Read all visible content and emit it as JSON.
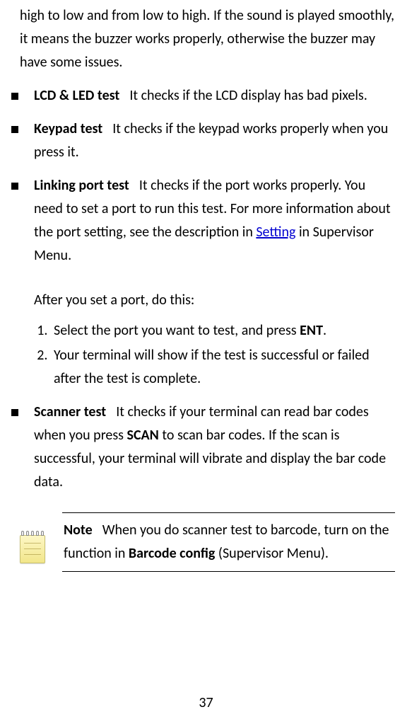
{
  "trailing": "high to low and from low to high. If the sound is played smoothly, it means the buzzer works properly, otherwise the buzzer may have some issues.",
  "tests": {
    "lcd": {
      "title": "LCD & LED test",
      "desc": "It checks if the LCD display has bad pixels."
    },
    "keypad": {
      "title": "Keypad test",
      "desc": "It checks if the keypad works properly when you press it."
    },
    "linking": {
      "title": "Linking port test",
      "desc_a": "It checks if the port works properly. You need to set a port to run this test. For more information about the port setting, see the description in ",
      "link": "Setting",
      "desc_b": " in Supervisor Menu.",
      "after": "After you set a port, do this:",
      "step1_a": "Select the port you want to test, and press ",
      "step1_b": "ENT",
      "step1_c": ".",
      "step2": "Your terminal will show if the test is successful or failed after the test is complete."
    },
    "scanner": {
      "title": "Scanner test",
      "desc_a": "It checks if your terminal can read bar codes when you press ",
      "scan": "SCAN",
      "desc_b": " to scan bar codes. If the scan is successful, your terminal will vibrate and display the bar code data."
    }
  },
  "note": {
    "label": "Note",
    "text_a": "When you do scanner test to barcode, turn on the function in ",
    "bold": "Barcode config",
    "text_b": " (Supervisor Menu)."
  },
  "page": "37"
}
